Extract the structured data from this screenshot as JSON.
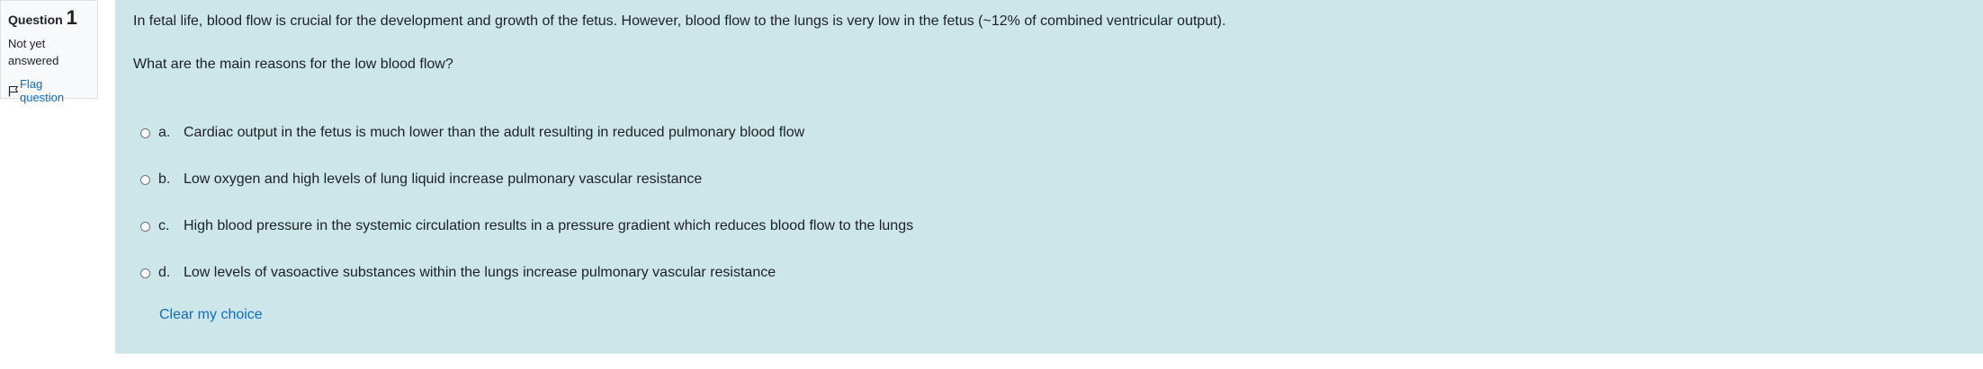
{
  "question_info": {
    "label": "Question",
    "number": "1",
    "state": "Not yet answered",
    "flag_label": "Flag question"
  },
  "question": {
    "text": "In fetal life, blood flow is crucial for the development and growth of the fetus. However, blood flow to the lungs is very low in the fetus (~12% of combined ventricular output).",
    "prompt": "What are the main reasons for the low blood flow?"
  },
  "answers": [
    {
      "letter": "a.",
      "text": "Cardiac output in the fetus is much lower than the adult resulting in reduced pulmonary blood flow"
    },
    {
      "letter": "b.",
      "text": "Low oxygen and high levels of lung liquid increase pulmonary vascular resistance"
    },
    {
      "letter": "c.",
      "text": "High blood pressure in the systemic circulation results in a pressure gradient which reduces blood flow to the lungs"
    },
    {
      "letter": "d.",
      "text": "Low levels of vasoactive substances within the lungs increase pulmonary vascular resistance"
    }
  ],
  "clear_label": "Clear my choice",
  "colors": {
    "panel_bg": "#cce6ea",
    "link": "#0f6cbf"
  }
}
